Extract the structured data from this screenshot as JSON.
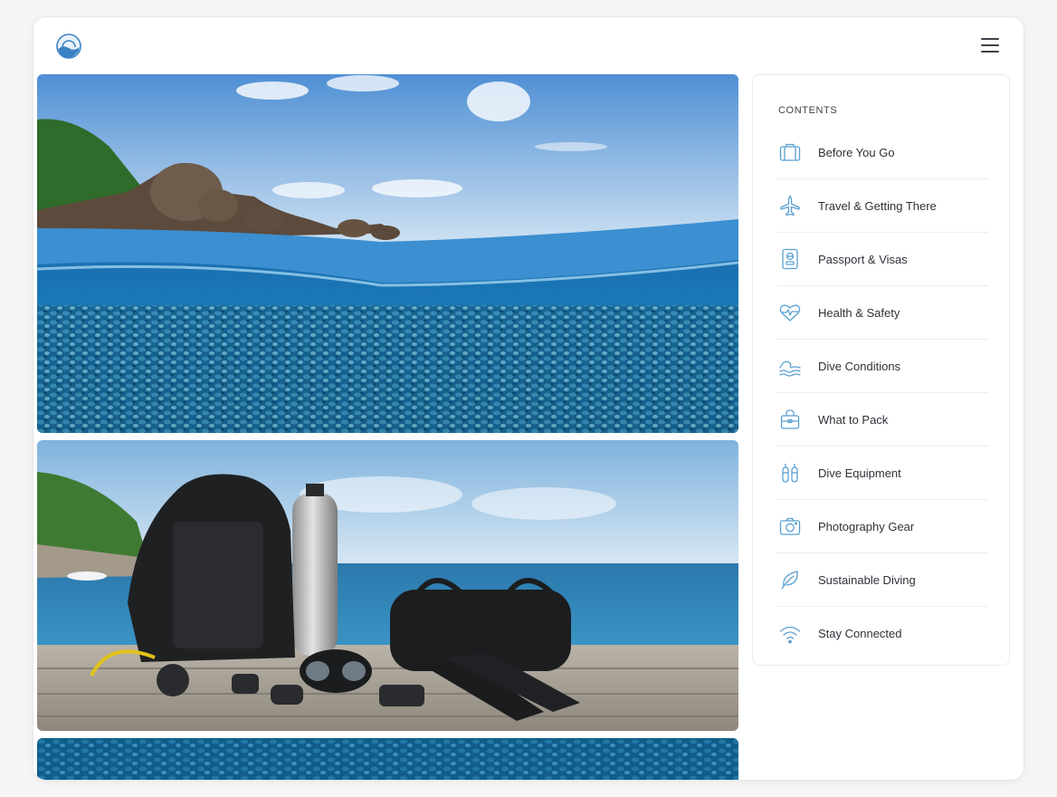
{
  "header": {
    "logo_icon": "wave-sun-logo-icon",
    "menu_icon": "hamburger-menu-icon"
  },
  "photos": [
    {
      "subject": "split-level-ocean-reef-photo"
    },
    {
      "subject": "dive-gear-on-dock-photo"
    },
    {
      "subject": "reef-water-photo"
    }
  ],
  "contents": {
    "heading": "CONTENTS",
    "items": [
      {
        "label": "Before You Go",
        "icon": "suitcase-icon"
      },
      {
        "label": "Travel & Getting There",
        "icon": "airplane-icon"
      },
      {
        "label": "Passport & Visas",
        "icon": "passport-icon"
      },
      {
        "label": "Health & Safety",
        "icon": "heart-pulse-icon"
      },
      {
        "label": "Dive Conditions",
        "icon": "waves-icon"
      },
      {
        "label": "What to Pack",
        "icon": "bag-icon"
      },
      {
        "label": "Dive Equipment",
        "icon": "tanks-icon"
      },
      {
        "label": "Photography Gear",
        "icon": "camera-icon"
      },
      {
        "label": "Sustainable Diving",
        "icon": "leaf-icon"
      },
      {
        "label": "Stay Connected",
        "icon": "wifi-icon"
      }
    ]
  },
  "colors": {
    "accent": "#5a9fd0",
    "text": "#2d3238",
    "background": "#f5f5f6"
  }
}
